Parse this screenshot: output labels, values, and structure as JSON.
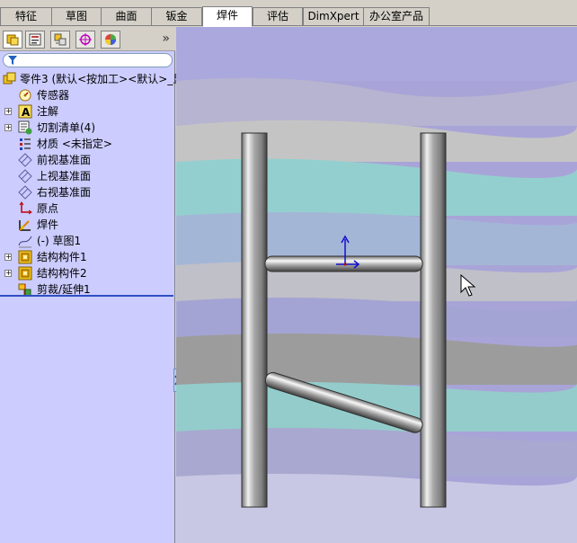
{
  "command_tabs": [
    {
      "label": "特征",
      "active": false
    },
    {
      "label": "草图",
      "active": false
    },
    {
      "label": "曲面",
      "active": false
    },
    {
      "label": "钣金",
      "active": false
    },
    {
      "label": "焊件",
      "active": true
    },
    {
      "label": "评估",
      "active": false
    },
    {
      "label": "DimXpert",
      "active": false
    },
    {
      "label": "办公室产品",
      "active": false
    }
  ],
  "panel": {
    "tabs": [
      "featuremanager-icon",
      "propertymanager-icon",
      "configurationmanager-icon",
      "dimxpert-icon",
      "display-manager-icon"
    ],
    "expand_glyph": "»"
  },
  "tree": {
    "root": "零件3  (默认<按加工><默认>_显",
    "items": [
      {
        "label": "传感器",
        "icon": "sensor-icon",
        "expandable": false
      },
      {
        "label": "注解",
        "icon": "annotation-icon",
        "expandable": true
      },
      {
        "label": "切割清单(4)",
        "icon": "cut-list-icon",
        "expandable": true
      },
      {
        "label": "材质 <未指定>",
        "icon": "material-icon",
        "expandable": false
      },
      {
        "label": "前视基准面",
        "icon": "plane-icon",
        "expandable": false
      },
      {
        "label": "上视基准面",
        "icon": "plane-icon",
        "expandable": false
      },
      {
        "label": "右视基准面",
        "icon": "plane-icon",
        "expandable": false
      },
      {
        "label": "原点",
        "icon": "origin-icon",
        "expandable": false
      },
      {
        "label": "焊件",
        "icon": "weldment-icon",
        "expandable": false
      },
      {
        "label": "(-) 草图1",
        "icon": "sketch-icon",
        "expandable": false
      },
      {
        "label": "结构构件1",
        "icon": "structural-member-icon",
        "expandable": true
      },
      {
        "label": "结构构件2",
        "icon": "structural-member-icon",
        "expandable": true
      },
      {
        "label": "剪裁/延伸1",
        "icon": "trim-extend-icon",
        "expandable": false
      }
    ]
  },
  "colors": {
    "panel_bg": "#ccccff",
    "accent": "#3050c0",
    "viewport_bg": "#a8a4d8"
  }
}
